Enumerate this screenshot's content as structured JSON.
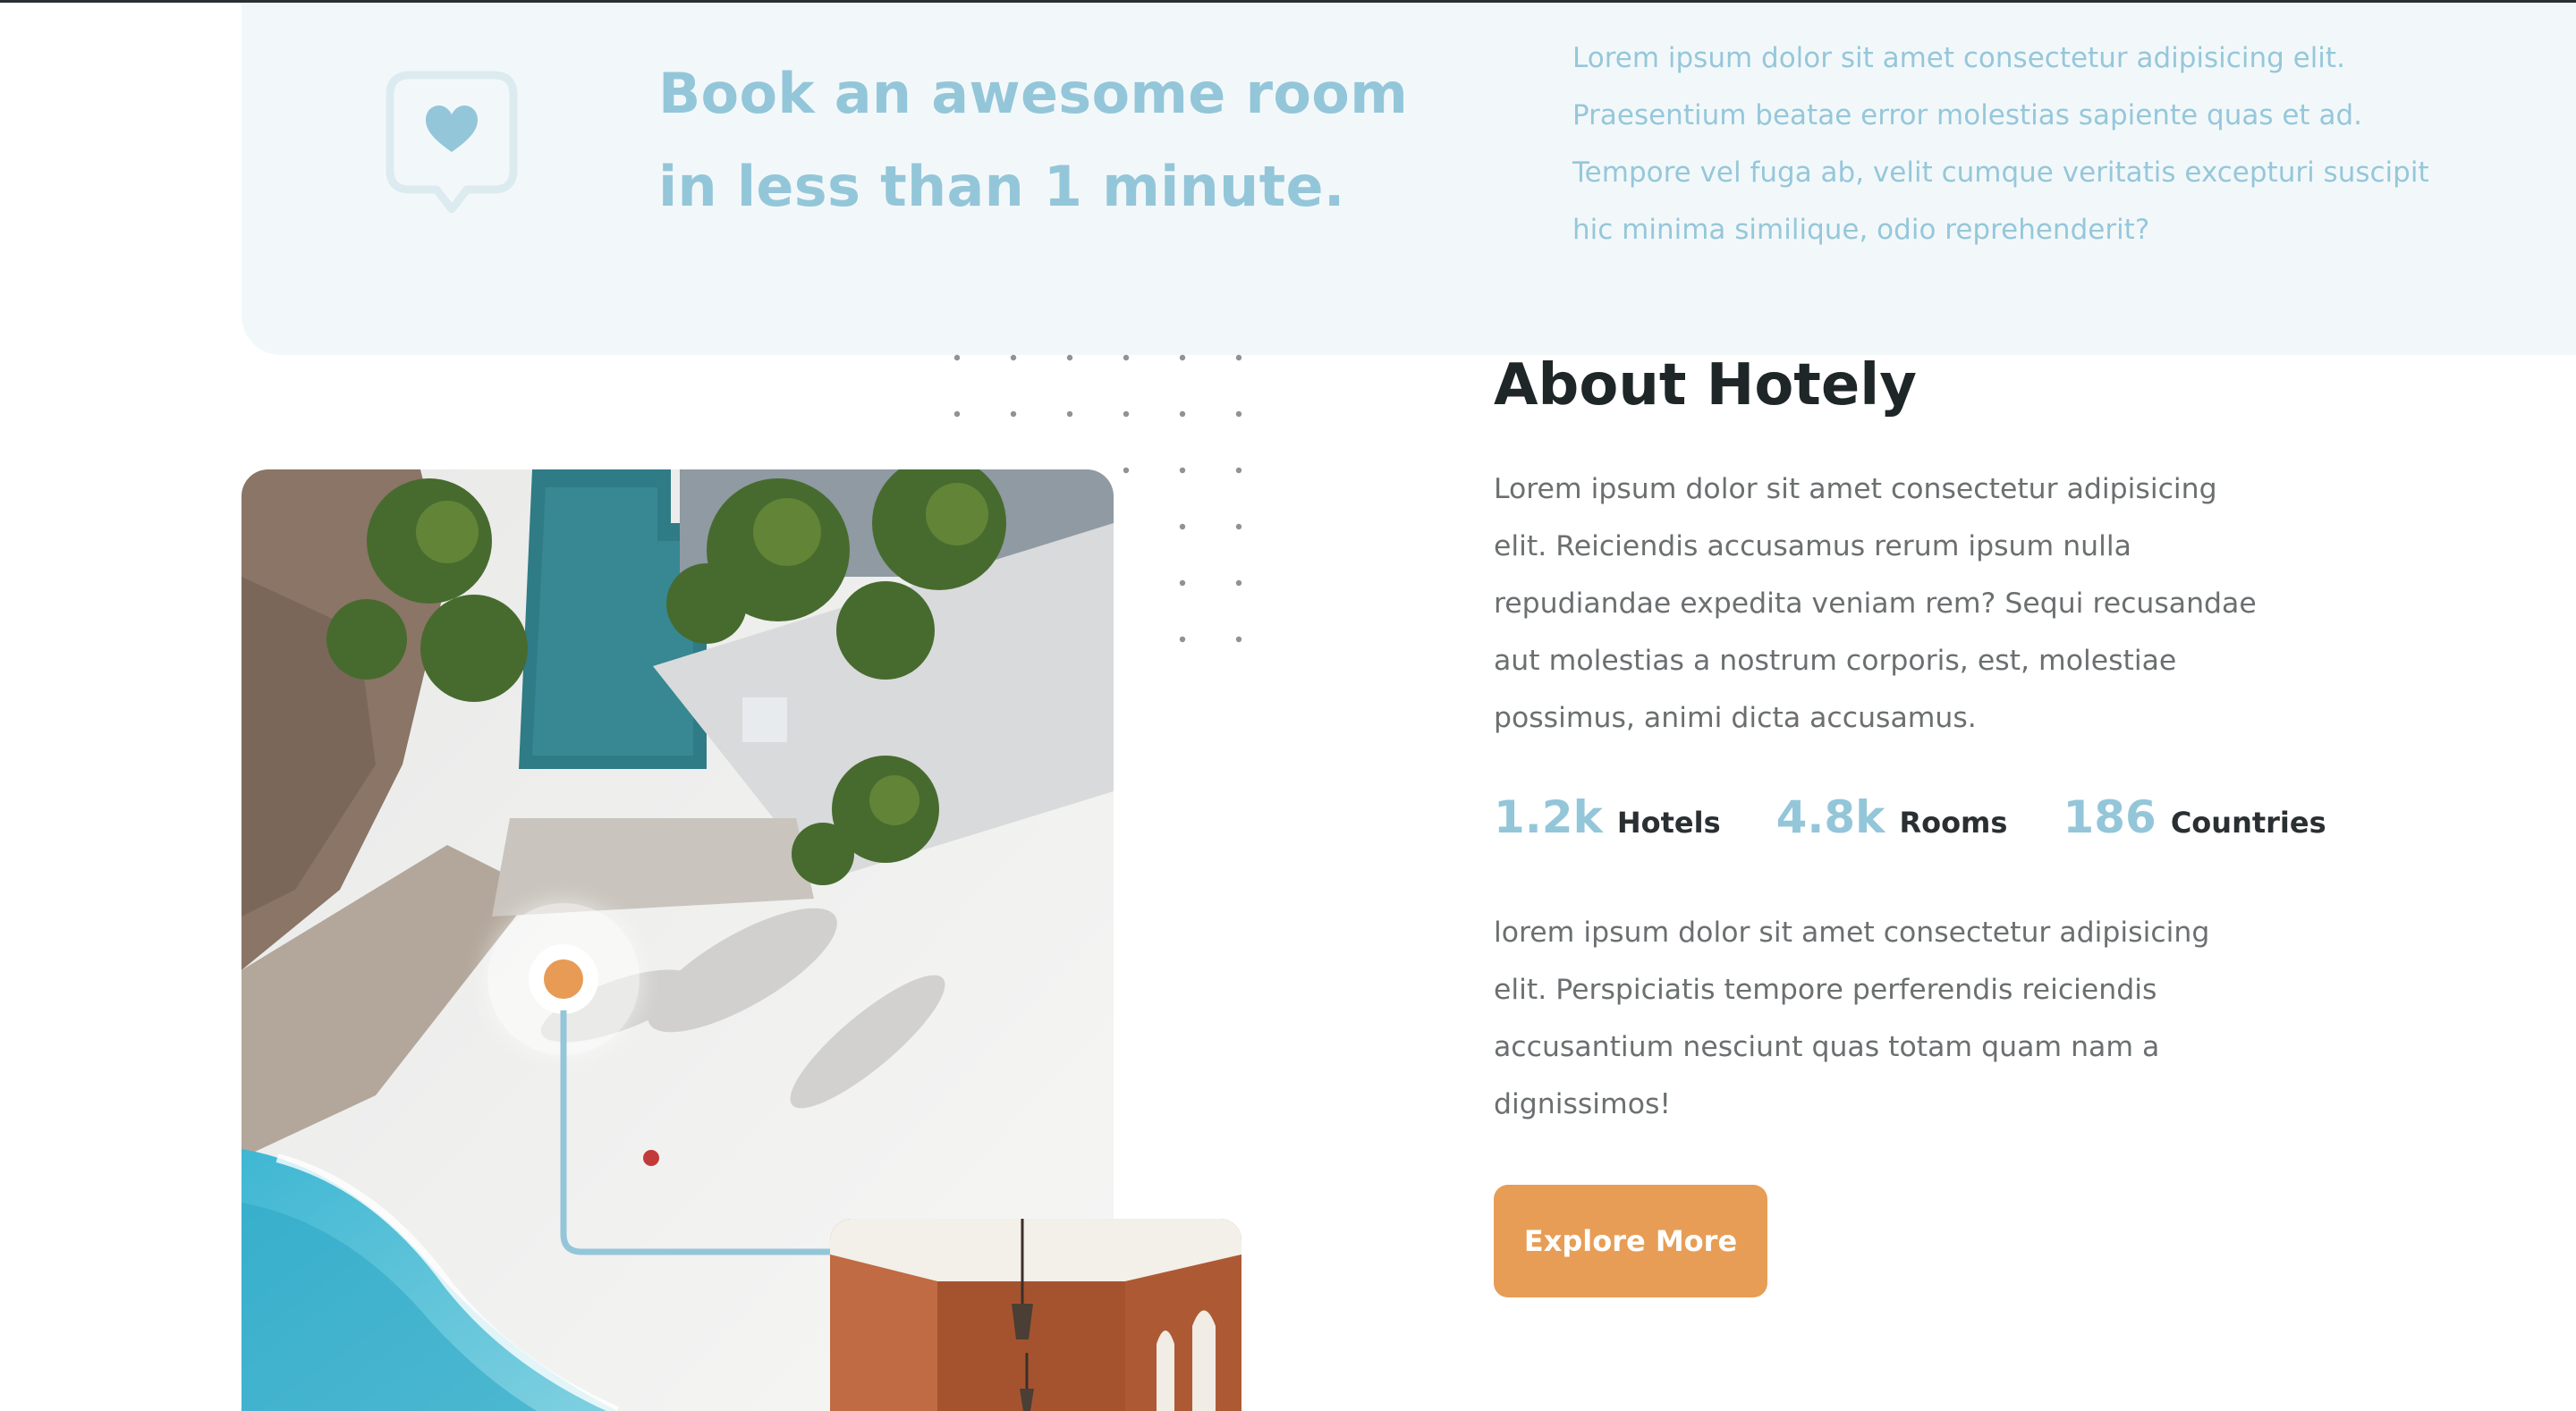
{
  "banner": {
    "icon": "heart-chat-bubble-icon",
    "title": "Book an awesome room in less than 1 minute.",
    "text": "Lorem ipsum dolor sit amet consectetur adipisicing elit. Praesentium beatae error molestias sapiente quas et ad. Tempore vel fuga ab, velit cumque veritatis excepturi suscipit hic minima similique, odio reprehenderit?"
  },
  "about": {
    "title": "About Hotely",
    "paragraph1": "Lorem ipsum dolor sit amet consectetur adipisicing elit. Reiciendis accusamus rerum ipsum nulla repudiandae expedita veniam rem? Sequi recusandae aut molestias a nostrum corporis, est, molestiae possimus, animi dicta accusamus.",
    "stats": [
      {
        "value": "1.2k",
        "label": "Hotels"
      },
      {
        "value": "4.8k",
        "label": "Rooms"
      },
      {
        "value": "186",
        "label": "Countries"
      }
    ],
    "paragraph2": "lorem ipsum dolor sit amet consectetur adipisicing elit. Perspiciatis tempore perferendis reiciendis accusantium nesciunt quas totam quam nam a dignissimos!",
    "button_label": "Explore More"
  },
  "colors": {
    "accent_blue": "#94c6d9",
    "accent_orange": "#e79d55",
    "banner_bg": "#f2f8fa",
    "heading": "#1f2628",
    "body_text": "#6b6f70"
  },
  "images": {
    "main_photo": "aerial-beach-resort-photo",
    "secondary_photo": "hotel-corridor-photo",
    "location_pin": "location-pin-icon"
  }
}
